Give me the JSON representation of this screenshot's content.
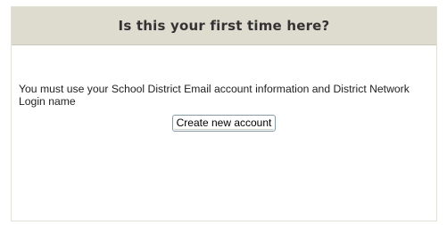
{
  "panel": {
    "title": "Is this your first time here?",
    "message": "You must use your School District Email account information and District Network Login name",
    "create_account_label": "Create new account"
  }
}
